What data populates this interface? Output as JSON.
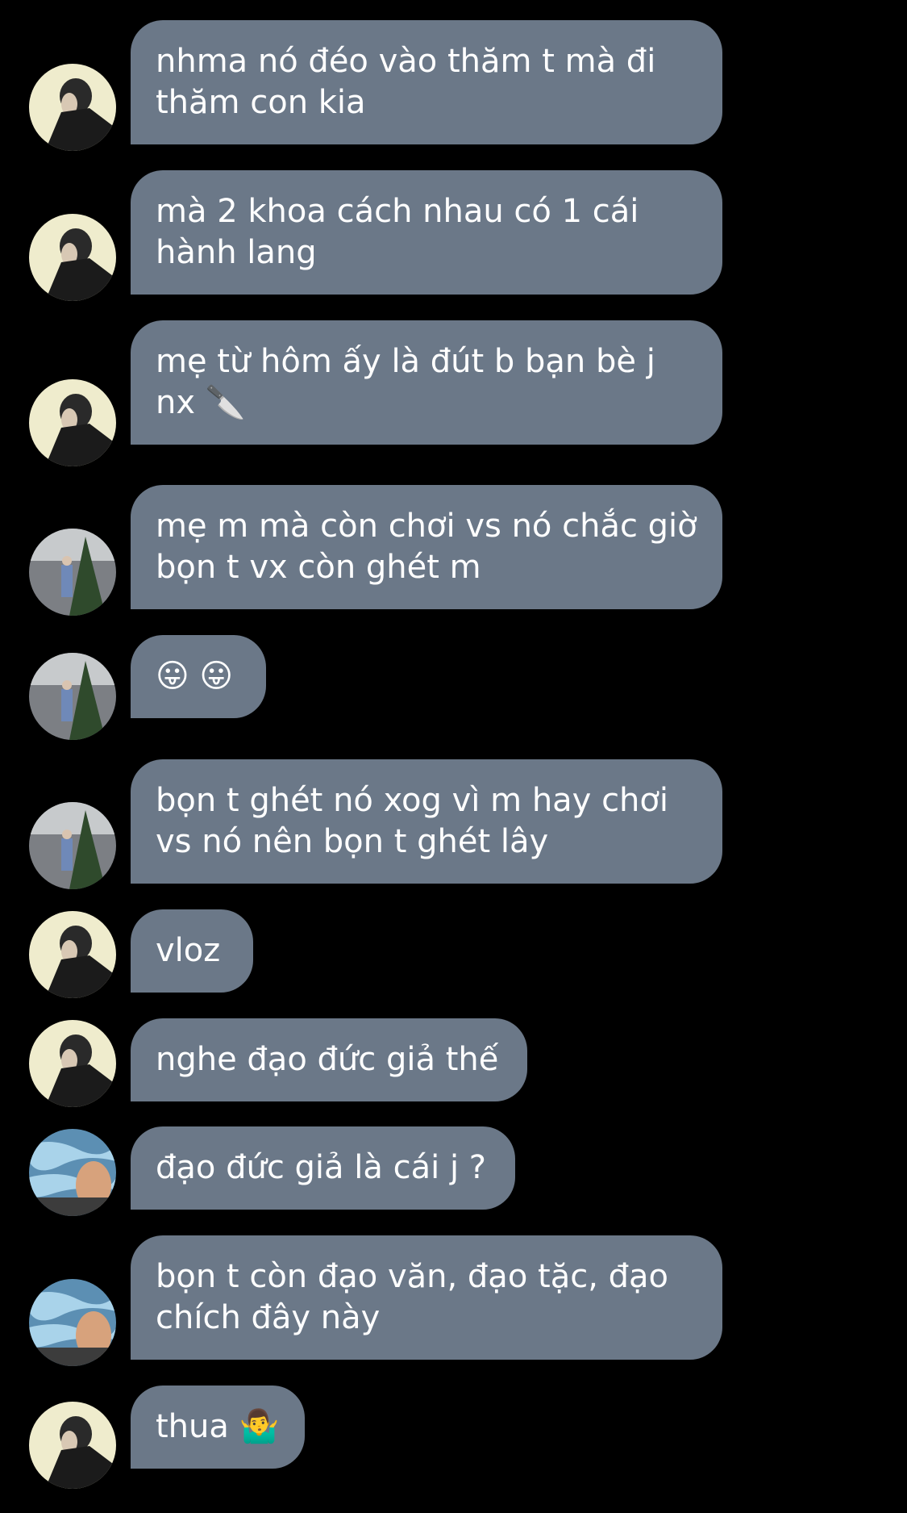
{
  "colors": {
    "background": "#000000",
    "bubble": "#6b7888",
    "text": "#ffffff"
  },
  "avatars": {
    "A": "avatar-man-dark-jacket-cream-background",
    "B": "avatar-person-standing-by-tree",
    "C": "avatar-person-lying-by-pool"
  },
  "messages": [
    {
      "avatar": "A",
      "text": "nhma nó đéo vào thăm t mà đi thăm con kia"
    },
    {
      "avatar": "A",
      "text": "mà 2 khoa cách nhau có 1 cái hành lang"
    },
    {
      "avatar": "A",
      "text": "mẹ từ hôm ấy là đút b bạn bè j nx 🔪"
    },
    {
      "avatar": "B",
      "text": "mẹ m mà còn chơi vs nó chắc giờ bọn t vx còn ghét m"
    },
    {
      "avatar": "B",
      "text": "😛 😛"
    },
    {
      "avatar": "B",
      "text": "bọn t ghét nó xog vì m hay chơi vs nó nên bọn t ghét lây"
    },
    {
      "avatar": "A",
      "text": "vloz"
    },
    {
      "avatar": "A",
      "text": "nghe đạo đức giả thế"
    },
    {
      "avatar": "C",
      "text": "đạo đức giả là cái j ?"
    },
    {
      "avatar": "C",
      "text": "bọn t còn đạo văn, đạo tặc, đạo chích đây này"
    },
    {
      "avatar": "A",
      "text": "thua 🤷‍♂️"
    }
  ]
}
